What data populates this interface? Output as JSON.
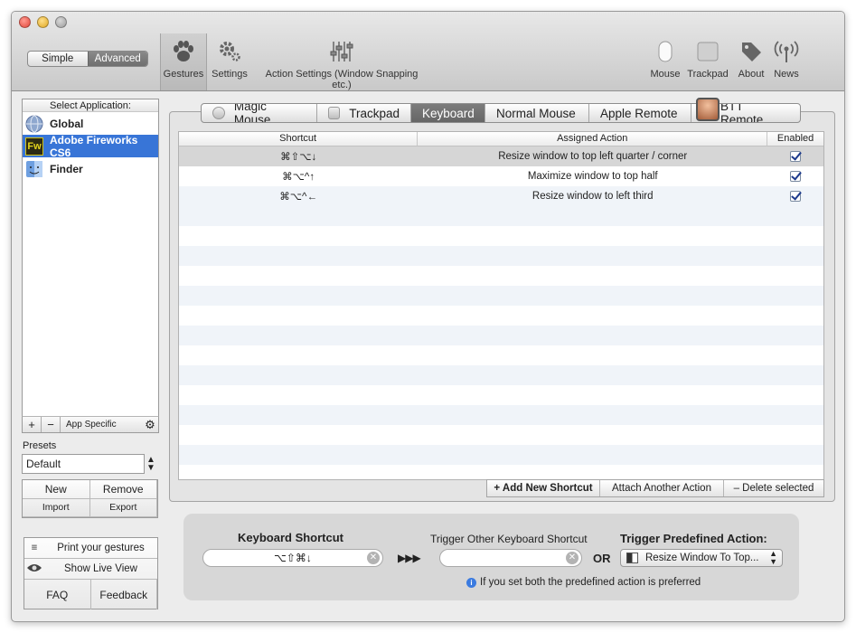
{
  "mode": {
    "simple": "Simple",
    "advanced": "Advanced"
  },
  "toolbar": {
    "gestures": "Gestures",
    "settings": "Settings",
    "action_settings": "Action Settings (Window Snapping etc.)",
    "mouse": "Mouse",
    "trackpad": "Trackpad",
    "about": "About",
    "news": "News"
  },
  "sidebar": {
    "header": "Select Application:",
    "apps": [
      {
        "label": "Global",
        "icon": "globe-icon"
      },
      {
        "label": "Adobe Fireworks CS6",
        "icon": "fireworks-icon",
        "icon_text": "Fw"
      },
      {
        "label": "Finder",
        "icon": "finder-icon"
      }
    ],
    "footer": {
      "add": "+",
      "remove": "−",
      "app_specific": "App Specific"
    }
  },
  "presets": {
    "label": "Presets",
    "selected": "Default",
    "new": "New",
    "remove": "Remove",
    "import": "Import",
    "export": "Export"
  },
  "bottom_buttons": {
    "print": "Print your gestures",
    "live_view": "Show Live View",
    "faq": "FAQ",
    "feedback": "Feedback"
  },
  "tabs": [
    "Magic Mouse",
    "Trackpad",
    "Keyboard",
    "Normal Mouse",
    "Apple Remote",
    "BTT Remote"
  ],
  "table": {
    "headers": {
      "shortcut": "Shortcut",
      "action": "Assigned Action",
      "enabled": "Enabled"
    },
    "rows": [
      {
        "shortcut": "⌘⇧⌥↓",
        "action": "Resize window to top left quarter / corner",
        "enabled": true
      },
      {
        "shortcut": "⌘⌥^↑",
        "action": "Maximize window to top half",
        "enabled": true
      },
      {
        "shortcut": "⌘⌥^←",
        "action": "Resize window to left third",
        "enabled": true
      }
    ]
  },
  "table_actions": {
    "add": "+ Add New Shortcut",
    "attach": "Attach Another Action",
    "delete": "– Delete selected"
  },
  "trigger": {
    "keyboard_label": "Keyboard Shortcut",
    "keyboard_value": "⌥⇧⌘↓",
    "arrows": "▶▶▶",
    "other_label": "Trigger Other Keyboard Shortcut",
    "other_value": "",
    "or": "OR",
    "predefined_label": "Trigger Predefined Action:",
    "predefined_value": "Resize Window To Top...",
    "info": "If you set both the predefined action is preferred"
  },
  "colors": {
    "selection": "#3875d7",
    "checkbox": "#1d3a8c"
  }
}
